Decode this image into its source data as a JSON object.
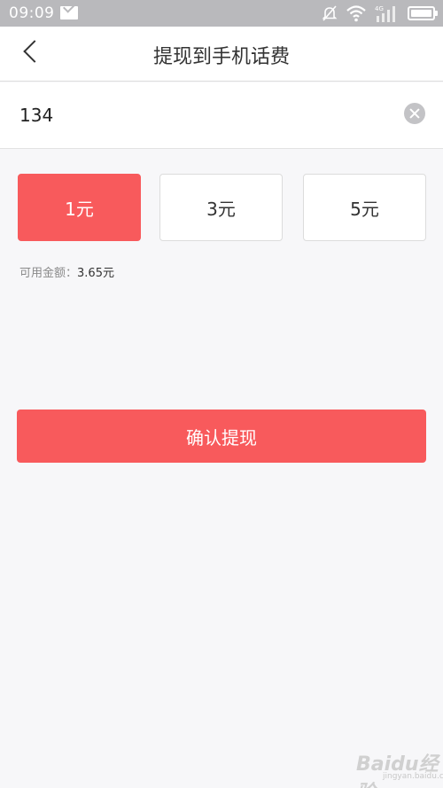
{
  "status_bar": {
    "time": "09:09",
    "network": "4G"
  },
  "header": {
    "title": "提现到手机话费"
  },
  "phone_input": {
    "value": "134"
  },
  "amount_options": [
    {
      "label": "1元",
      "selected": true
    },
    {
      "label": "3元",
      "selected": false
    },
    {
      "label": "5元",
      "selected": false
    }
  ],
  "balance": {
    "label": "可用金额：",
    "value": "3.65元"
  },
  "confirm_button": {
    "label": "确认提现"
  },
  "colors": {
    "accent": "#f85a5c",
    "status_bar": "#b9b9bc"
  },
  "watermark": {
    "brand": "Baidu经验",
    "url": "jingyan.baidu.com"
  }
}
